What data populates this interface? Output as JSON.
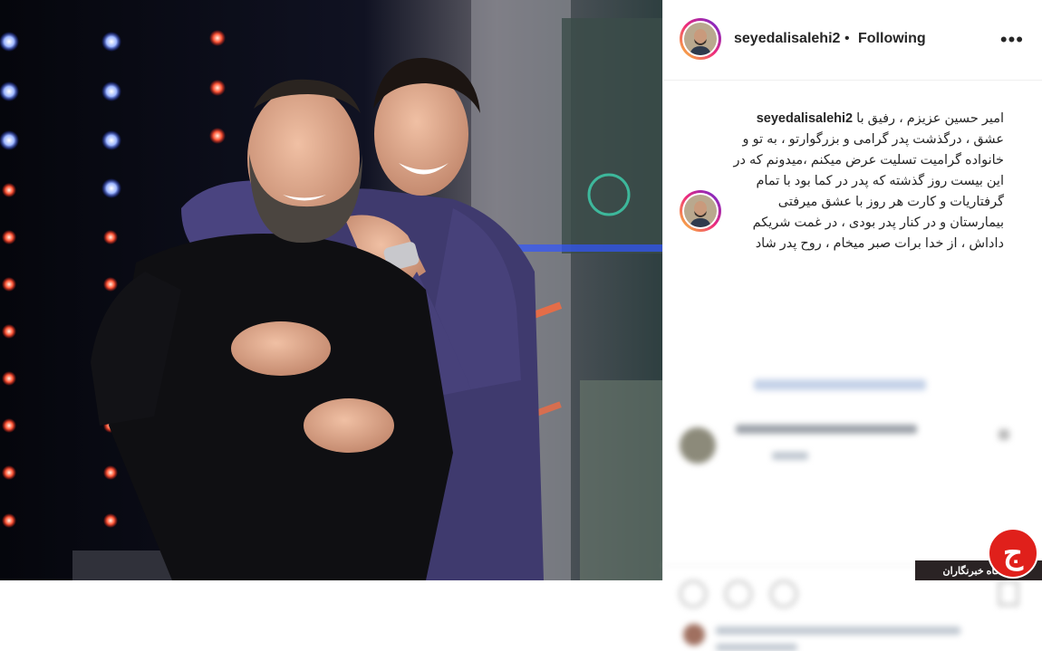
{
  "post": {
    "username": "seyedalisalehi2",
    "separator": "•",
    "follow_status": "Following",
    "more_glyph": "•••"
  },
  "caption": {
    "username": "seyedalisalehi2",
    "lines": [
      "امیر حسین عزیزم ، رفیق با",
      "عشق ، درگذشت پدر گرامی و بزرگوارتو ، به تو و",
      "خانواده گرامیت تسلیت عرض میکنم ،میدونم که در",
      "این بیست روز گذشته که پدر در کما بود با تمام",
      "گرفتاریات و کارت هر روز با عشق میرفتی",
      "بیمارستان و در کنار پدر بودی ، در غمت شریکم",
      "داداش ، از خدا برات صبر میخام ، روح پدر شاد"
    ]
  },
  "watermark": {
    "text": "باشگاه خبرنگاران",
    "logo_letter": "ج"
  }
}
